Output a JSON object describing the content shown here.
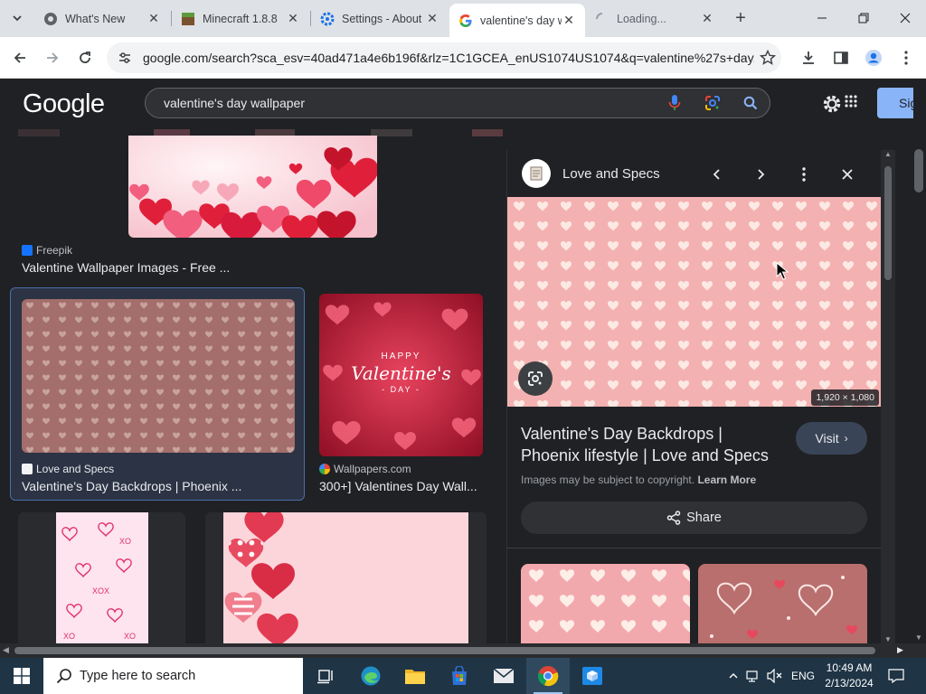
{
  "browser": {
    "tabs": [
      {
        "title": "What's New",
        "active": false
      },
      {
        "title": "Minecraft 1.8.8",
        "active": false
      },
      {
        "title": "Settings - About",
        "active": false
      },
      {
        "title": "valentine's day wallpaper",
        "active": true
      },
      {
        "title": "Loading...",
        "active": false
      }
    ],
    "url": "google.com/search?sca_esv=40ad471a4e6b196f&rlz=1C1GCEA_enUS1074US1074&q=valentine%27s+day..."
  },
  "google": {
    "logo": "Google",
    "query": "valentine's day wallpaper",
    "signin_label": "Sign in"
  },
  "results": [
    {
      "source": "Freepik",
      "title": "Valentine Wallpaper Images - Free ..."
    },
    {
      "source": "Love and Specs",
      "title": "Valentine's Day Backdrops | Phoenix ..."
    },
    {
      "source": "Wallpapers.com",
      "title": "300+] Valentines Day Wall...",
      "overlay_line1": "HAPPY",
      "overlay_line2": "Valentine's",
      "overlay_line3": "- DAY -"
    }
  ],
  "panel": {
    "site_name": "Love and Specs",
    "dimensions": "1,920 × 1,080",
    "title": "Valentine's Day Backdrops | Phoenix lifestyle | Love and Specs",
    "visit_label": "Visit",
    "copyright_text": "Images may be subject to copyright.",
    "learn_more": "Learn More",
    "share_label": "Share"
  },
  "taskbar": {
    "search_placeholder": "Type here to search",
    "language": "ENG",
    "time": "10:49 AM",
    "date": "2/13/2024"
  },
  "colors": {
    "accent_blue": "#8ab4f8",
    "selected_border": "#4b6ea8",
    "pink_bg": "#f4b1b1",
    "taskbar": "#1f3445"
  }
}
